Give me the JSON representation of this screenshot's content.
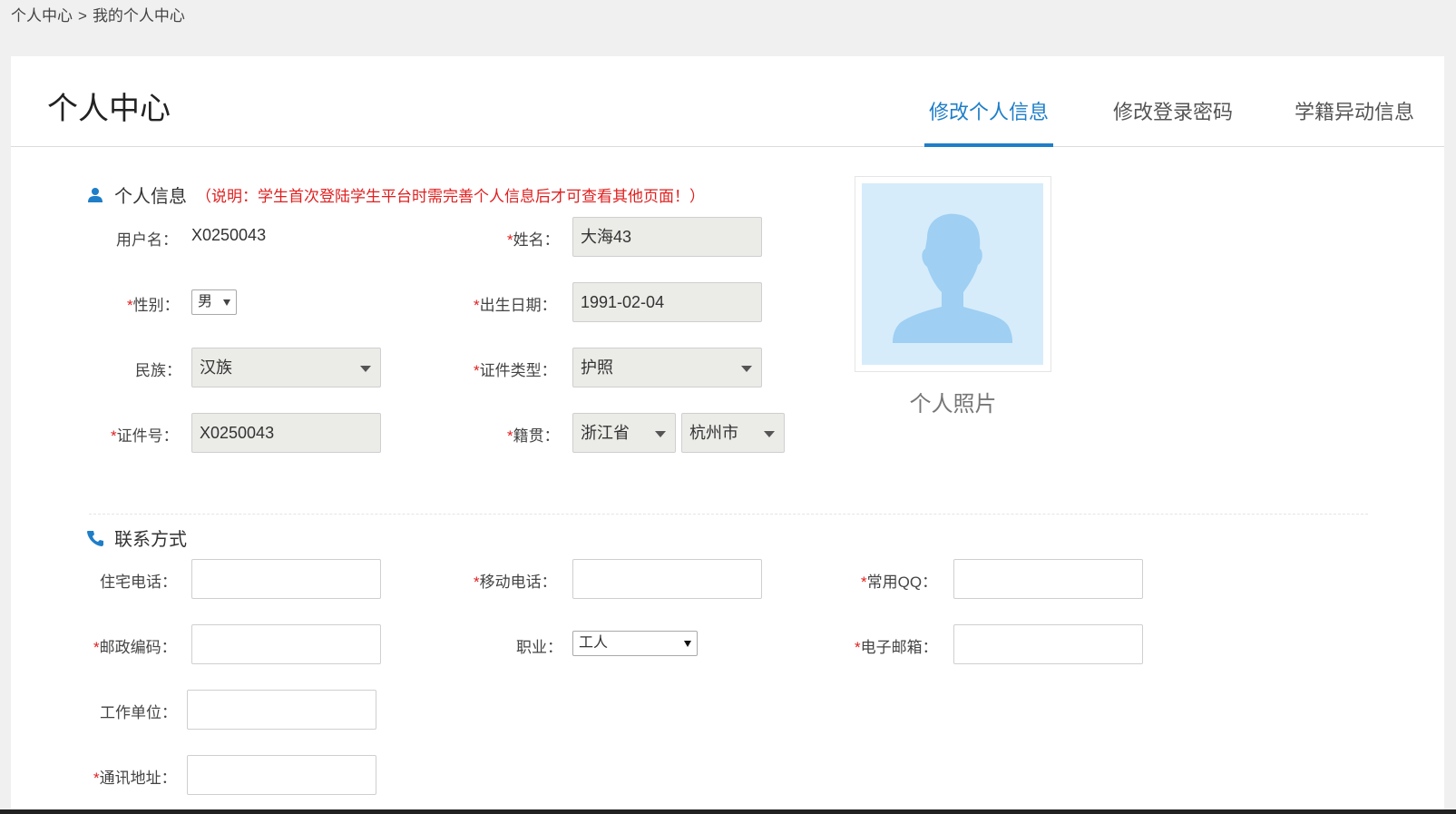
{
  "breadcrumb": {
    "root": "个人中心",
    "sep": ">",
    "current": "我的个人中心"
  },
  "header": {
    "title": "个人中心",
    "tabs": [
      {
        "label": "修改个人信息",
        "active": true
      },
      {
        "label": "修改登录密码",
        "active": false
      },
      {
        "label": "学籍异动信息",
        "active": false
      }
    ]
  },
  "personal": {
    "section_title": "个人信息",
    "note": "（说明：学生首次登陆学生平台时需完善个人信息后才可查看其他页面！）",
    "required_mark": "*",
    "username_label": "用户名：",
    "username_value": "X0250043",
    "name_label": "姓名：",
    "name_value": "大海43",
    "gender_label": "性别：",
    "gender_value": "男",
    "birth_label": "出生日期：",
    "birth_value": "1991-02-04",
    "ethnicity_label": "民族：",
    "ethnicity_value": "汉族",
    "id_type_label": "证件类型：",
    "id_type_value": "护照",
    "id_no_label": "证件号：",
    "id_no_value": "X0250043",
    "native_label": "籍贯：",
    "province_value": "浙江省",
    "city_value": "杭州市",
    "photo_caption": "个人照片"
  },
  "contact": {
    "section_title": "联系方式",
    "home_phone_label": "住宅电话：",
    "home_phone_value": "",
    "mobile_label": "移动电话：",
    "mobile_value": "",
    "qq_label": "常用QQ：",
    "qq_value": "",
    "postcode_label": "邮政编码：",
    "postcode_value": "",
    "job_label": "职业：",
    "job_value": "工人",
    "email_label": "电子邮箱：",
    "email_value": "",
    "workplace_label": "工作单位：",
    "workplace_value": "",
    "address_label": "通讯地址：",
    "address_value": ""
  },
  "colors": {
    "accent": "#1e7ec8",
    "required": "#e02020",
    "readonly_bg": "#ebebe8"
  }
}
